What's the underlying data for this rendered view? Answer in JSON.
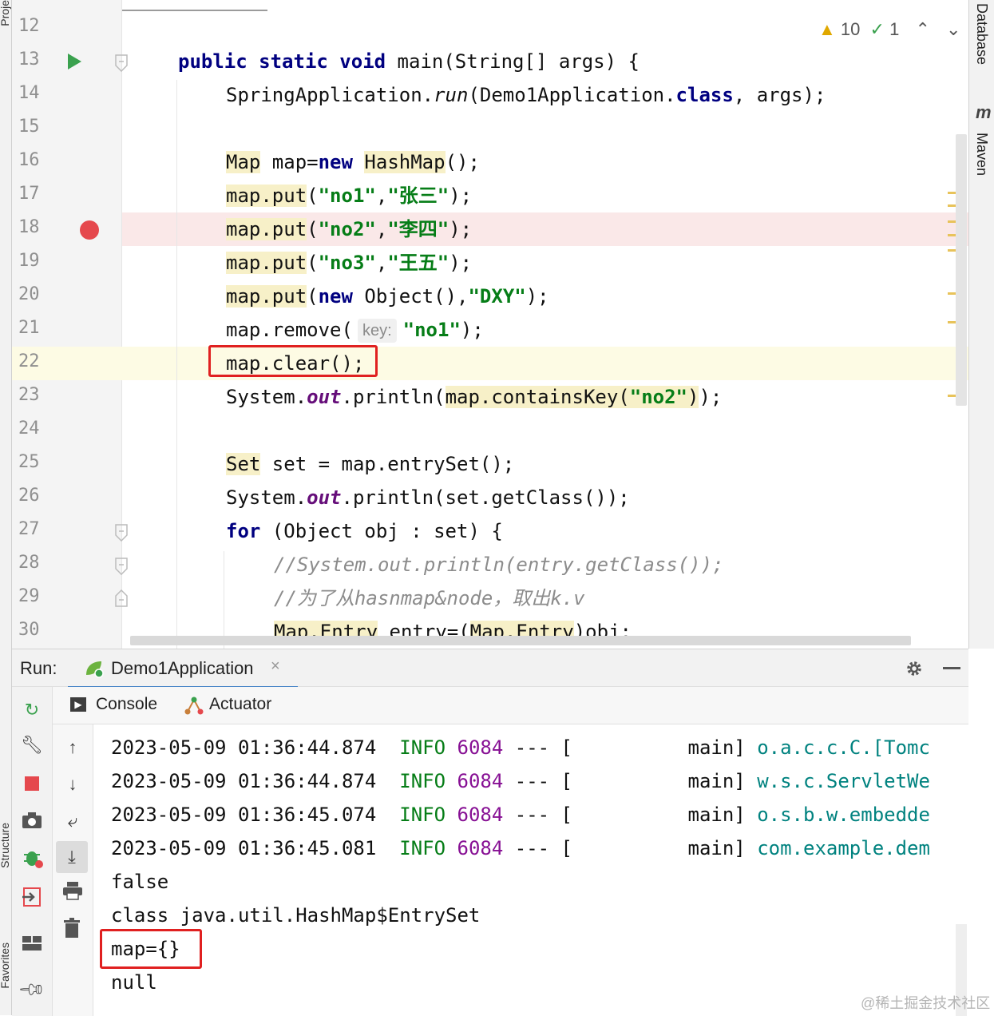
{
  "left_stripe": {
    "labels": [
      "Proje",
      "Structure",
      "Favorites"
    ]
  },
  "right_rail": {
    "database_label": "Database",
    "maven_label": "Maven",
    "maven_glyph": "m"
  },
  "editor": {
    "inspections": {
      "warnings": "10",
      "ok": "1"
    },
    "lines": [
      {
        "n": "12"
      },
      {
        "n": "13"
      },
      {
        "n": "14"
      },
      {
        "n": "15"
      },
      {
        "n": "16"
      },
      {
        "n": "17"
      },
      {
        "n": "18"
      },
      {
        "n": "19"
      },
      {
        "n": "20"
      },
      {
        "n": "21"
      },
      {
        "n": "22"
      },
      {
        "n": "23"
      },
      {
        "n": "24"
      },
      {
        "n": "25"
      },
      {
        "n": "26"
      },
      {
        "n": "27"
      },
      {
        "n": "28"
      },
      {
        "n": "29"
      },
      {
        "n": "30"
      }
    ],
    "code": {
      "l13": {
        "a": "public static void",
        "b": " main(String[] args) {"
      },
      "l14": {
        "a": "SpringApplication.",
        "b": "run",
        "c": "(Demo1Application.",
        "d": "class",
        "e": ", args);"
      },
      "l16": {
        "a": "Map",
        "b": " map=",
        "c": "new",
        "d": " ",
        "e": "HashMap",
        "f": "();"
      },
      "l17": {
        "a": "map.put",
        "b": "(",
        "c": "\"no1\"",
        "d": ",",
        "e": "\"张三\"",
        "f": ");"
      },
      "l18": {
        "a": "map.put",
        "b": "(",
        "c": "\"no2\"",
        "d": ",",
        "e": "\"李四\"",
        "f": ");"
      },
      "l19": {
        "a": "map.put",
        "b": "(",
        "c": "\"no3\"",
        "d": ",",
        "e": "\"王五\"",
        "f": ");"
      },
      "l20": {
        "a": "map.put",
        "b": "(",
        "c": "new",
        "d": " Object(),",
        "e": "\"DXY\"",
        "f": ");"
      },
      "l21": {
        "a": "map.remove(",
        "hint": "key:",
        "c": "\"no1\"",
        "d": ");"
      },
      "l22": {
        "a": "map.clear();"
      },
      "l23": {
        "a": "System.",
        "b": "out",
        "c": ".println(",
        "d": "map.containsKey(",
        "e": "\"no2\"",
        "f": ")",
        "g": ");"
      },
      "l25": {
        "a": "Set",
        "b": " set = map.entrySet();"
      },
      "l26": {
        "a": "System.",
        "b": "out",
        "c": ".println(set.getClass());"
      },
      "l27": {
        "a": "for",
        "b": " (Object obj : set) {"
      },
      "l28": {
        "a": "//System.out.println(entry.getClass());"
      },
      "l29": {
        "a": "//为了从hasnmap&node，取出k.v"
      },
      "l30": {
        "a": "Map.Entry",
        "b": " entry=(",
        "c": "Map.Entry",
        "d": ")obj;"
      }
    }
  },
  "run_panel": {
    "label": "Run:",
    "config_tab": "Demo1Application",
    "subtabs": {
      "console": "Console",
      "actuator": "Actuator"
    },
    "console": {
      "logs": [
        {
          "ts": "2023-05-09 01:36:44.874",
          "level": "INFO",
          "pid": "6084",
          "sep": " --- [",
          "thread": "main]",
          "logger": "o.a.c.c.C.[Tomc"
        },
        {
          "ts": "2023-05-09 01:36:44.874",
          "level": "INFO",
          "pid": "6084",
          "sep": " --- [",
          "thread": "main]",
          "logger": "w.s.c.ServletWe"
        },
        {
          "ts": "2023-05-09 01:36:45.074",
          "level": "INFO",
          "pid": "6084",
          "sep": " --- [",
          "thread": "main]",
          "logger": "o.s.b.w.embedde"
        },
        {
          "ts": "2023-05-09 01:36:45.081",
          "level": "INFO",
          "pid": "6084",
          "sep": " --- [",
          "thread": "main]",
          "logger": "com.example.dem"
        }
      ],
      "output": [
        "false",
        "class java.util.HashMap$EntrySet",
        "map={}",
        "null"
      ]
    }
  },
  "watermark": "@稀土掘金技术社区"
}
